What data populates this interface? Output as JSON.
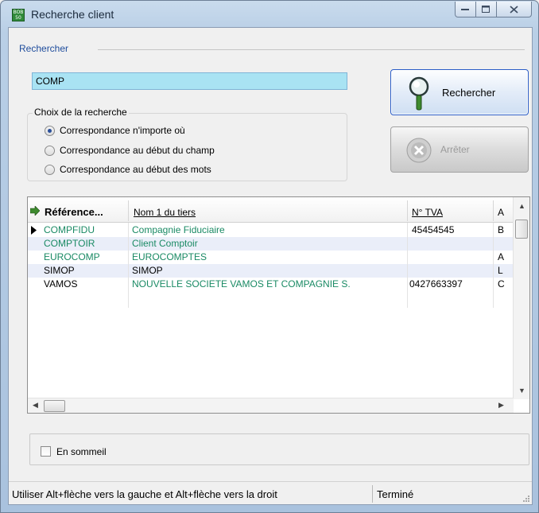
{
  "window": {
    "title": "Recherche client",
    "app_icon_text": "BOB 50"
  },
  "search": {
    "group_label": "Rechercher",
    "value": "COMP",
    "search_button_label": "Rechercher",
    "stop_button_label": "Arrêter"
  },
  "search_mode": {
    "legend": "Choix de la recherche",
    "options": [
      {
        "label": "Correspondance n'importe où",
        "selected": true
      },
      {
        "label": "Correspondance au début du champ",
        "selected": false
      },
      {
        "label": "Correspondance au début des mots",
        "selected": false
      }
    ]
  },
  "grid": {
    "columns": [
      "Référence...",
      "Nom 1 du tiers",
      "N° TVA",
      "A"
    ],
    "rows": [
      {
        "ref": "COMPFIDU",
        "name": "Compagnie Fiduciaire",
        "tva": "45454545",
        "extra": "B",
        "ref_color": "green",
        "name_color": "green",
        "current": true
      },
      {
        "ref": "COMPTOIR",
        "name": "Client Comptoir",
        "tva": "",
        "extra": "",
        "ref_color": "green",
        "name_color": "green",
        "current": false
      },
      {
        "ref": "EUROCOMP",
        "name": "EUROCOMPTES",
        "tva": "",
        "extra": "A",
        "ref_color": "green",
        "name_color": "green",
        "current": false
      },
      {
        "ref": "SIMOP",
        "name": "SIMOP",
        "tva": "",
        "extra": "L",
        "ref_color": "black",
        "name_color": "black",
        "current": false
      },
      {
        "ref": "VAMOS",
        "name": "NOUVELLE SOCIETE VAMOS ET COMPAGNIE S.",
        "tva": "0427663397",
        "extra": "C",
        "ref_color": "black",
        "name_color": "green",
        "current": false
      }
    ]
  },
  "filters": {
    "sleeping_label": "En sommeil",
    "sleeping_checked": false
  },
  "status": {
    "hint": "Utiliser Alt+flèche vers la gauche et Alt+flèche vers la droit",
    "state": "Terminé"
  },
  "colors": {
    "input_bg": "#a9e3f3",
    "green_text": "#1a8a64",
    "group_label": "#1e4c9c",
    "alt_row": "#eaeef9"
  }
}
